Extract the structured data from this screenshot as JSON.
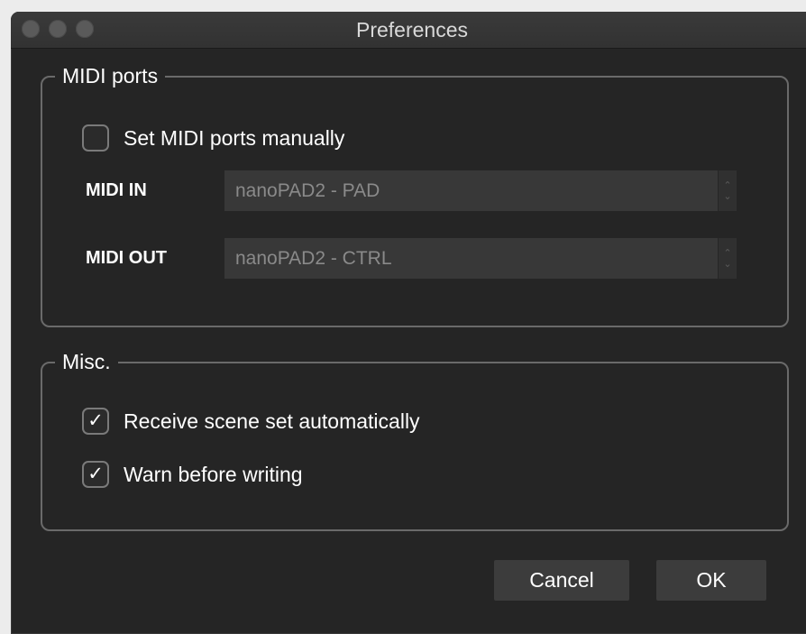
{
  "window": {
    "title": "Preferences"
  },
  "midi_ports": {
    "group_label": "MIDI ports",
    "manual": {
      "label": "Set MIDI ports manually",
      "checked": false
    },
    "midi_in": {
      "label": "MIDI IN",
      "value": "nanoPAD2 - PAD"
    },
    "midi_out": {
      "label": "MIDI OUT",
      "value": "nanoPAD2 - CTRL"
    }
  },
  "misc": {
    "group_label": "Misc.",
    "receive_scene": {
      "label": "Receive scene set automatically",
      "checked": true,
      "mark": "✓"
    },
    "warn_before_writing": {
      "label": "Warn before writing",
      "checked": true,
      "mark": "✓"
    }
  },
  "buttons": {
    "cancel": "Cancel",
    "ok": "OK"
  },
  "icons": {
    "stepper": "up-down-chevron-icon",
    "traffic_lights": [
      "close-button",
      "minimize-button",
      "zoom-button"
    ]
  }
}
